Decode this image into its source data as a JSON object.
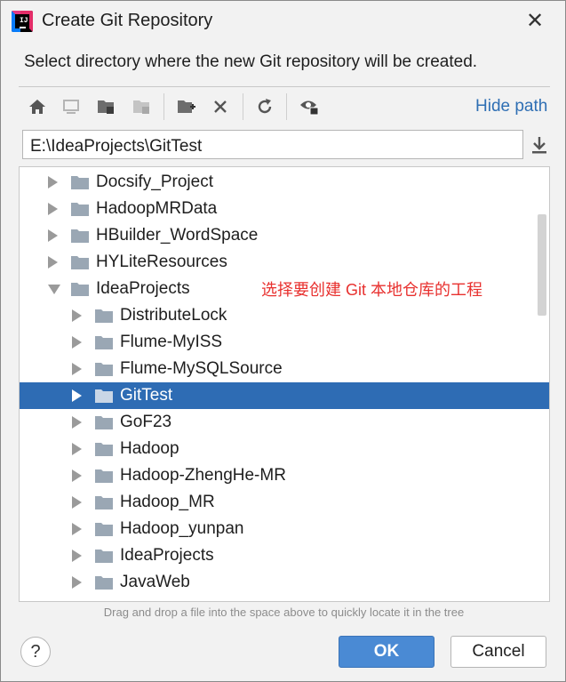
{
  "window": {
    "title": "Create Git Repository",
    "close_glyph": "✕"
  },
  "subtitle": "Select directory where the new Git repository will be created.",
  "toolbar": {
    "buttons": [
      "home-icon",
      "desktop-icon",
      "project-folder-icon",
      "module-folder-icon",
      "new-folder-icon",
      "delete-icon",
      "refresh-icon",
      "show-hidden-icon"
    ],
    "hide_path_label": "Hide path"
  },
  "path": {
    "value": "E:\\IdeaProjects\\GitTest"
  },
  "tree": {
    "items": [
      {
        "label": "Docsify_Project",
        "expanded": false,
        "selected": false
      },
      {
        "label": "HadoopMRData",
        "expanded": false,
        "selected": false
      },
      {
        "label": "HBuilder_WordSpace",
        "expanded": false,
        "selected": false
      },
      {
        "label": "HYLiteResources",
        "expanded": false,
        "selected": false
      },
      {
        "label": "IdeaProjects",
        "expanded": true,
        "selected": false
      },
      {
        "label": "DistributeLock",
        "expanded": false,
        "selected": false
      },
      {
        "label": "Flume-MyISS",
        "expanded": false,
        "selected": false
      },
      {
        "label": "Flume-MySQLSource",
        "expanded": false,
        "selected": false
      },
      {
        "label": "GitTest",
        "expanded": false,
        "selected": true
      },
      {
        "label": "GoF23",
        "expanded": false,
        "selected": false
      },
      {
        "label": "Hadoop",
        "expanded": false,
        "selected": false
      },
      {
        "label": "Hadoop-ZhengHe-MR",
        "expanded": false,
        "selected": false
      },
      {
        "label": "Hadoop_MR",
        "expanded": false,
        "selected": false
      },
      {
        "label": "Hadoop_yunpan",
        "expanded": false,
        "selected": false
      },
      {
        "label": "IdeaProjects",
        "expanded": false,
        "selected": false
      },
      {
        "label": "JavaWeb",
        "expanded": false,
        "selected": false
      }
    ],
    "annotation": "选择要创建 Git 本地仓库的工程"
  },
  "hint": "Drag and drop a file into the space above to quickly locate it in the tree",
  "buttons": {
    "help": "?",
    "ok": "OK",
    "cancel": "Cancel"
  },
  "colors": {
    "accent": "#2e6cb4",
    "ok_button": "#4a8ad4",
    "link": "#2f6fb4",
    "annotation": "#e8312f"
  }
}
